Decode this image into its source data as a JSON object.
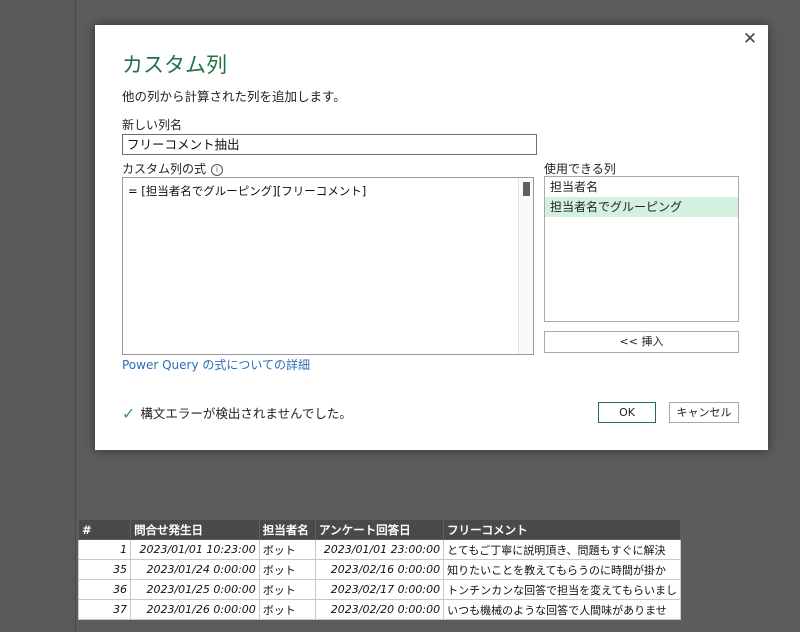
{
  "dialog": {
    "title": "カスタム列",
    "subtitle": "他の列から計算された列を追加します。",
    "new_column_label": "新しい列名",
    "new_column_value": "フリーコメント抽出",
    "formula_label": "カスタム列の式",
    "info_icon": "i",
    "formula_prefix": "= [",
    "formula_part1": "担当者名でグルーピング",
    "formula_bracket_close": "]",
    "formula_bracket_open": "[",
    "formula_part2": "フリーコメント",
    "formula_end": "]",
    "available_label": "使用できる列",
    "available_columns": [
      "担当者名",
      "担当者名でグルーピング"
    ],
    "insert_button": "<< 挿入",
    "learn_more_link": "Power Query の式についての詳細",
    "status_text": "構文エラーが検出されませんでした。",
    "ok_button": "OK",
    "cancel_button": "キャンセル",
    "close_icon": "close-icon",
    "accent_color": "#217346"
  },
  "table": {
    "headers": [
      "#",
      "問合せ発生日",
      "担当者名",
      "アンケート回答日",
      "フリーコメント"
    ],
    "rows": [
      [
        "1",
        "2023/01/01 10:23:00",
        "ボット",
        "2023/01/01 23:00:00",
        "とてもご丁寧に説明頂き、問題もすぐに解決"
      ],
      [
        "35",
        "2023/01/24 0:00:00",
        "ボット",
        "2023/02/16 0:00:00",
        "知りたいことを教えてもらうのに時間が掛か"
      ],
      [
        "36",
        "2023/01/25 0:00:00",
        "ボット",
        "2023/02/17 0:00:00",
        "トンチンカンな回答で担当を変えてもらいまし"
      ],
      [
        "37",
        "2023/01/26 0:00:00",
        "ボット",
        "2023/02/20 0:00:00",
        "いつも機械のような回答で人間味がありませ"
      ]
    ]
  }
}
